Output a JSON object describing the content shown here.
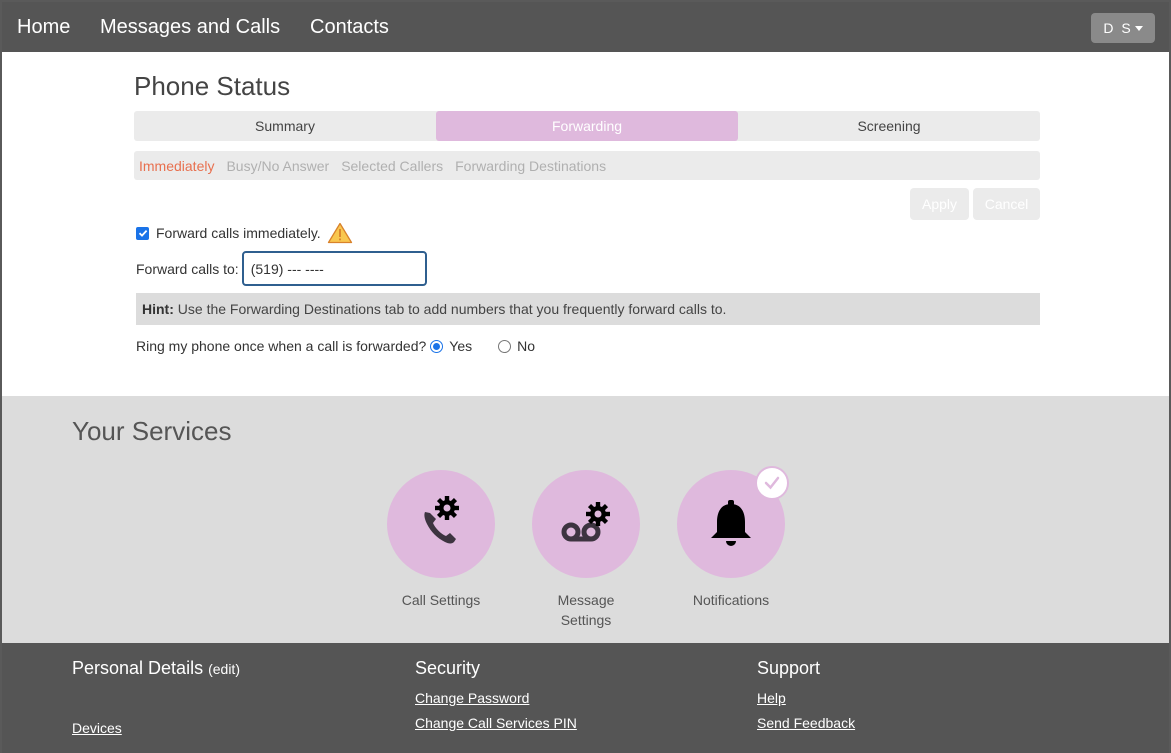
{
  "nav": {
    "items": [
      {
        "label": "Home"
      },
      {
        "label": "Messages and Calls"
      },
      {
        "label": "Contacts"
      }
    ],
    "user_initials": "D S"
  },
  "phone_status": {
    "title": "Phone Status",
    "tabs": [
      {
        "label": "Summary",
        "active": false
      },
      {
        "label": "Forwarding",
        "active": true
      },
      {
        "label": "Screening",
        "active": false
      }
    ],
    "subtabs": [
      {
        "label": "Immediately",
        "active": true
      },
      {
        "label": "Busy/No Answer",
        "active": false
      },
      {
        "label": "Selected Callers",
        "active": false
      },
      {
        "label": "Forwarding Destinations",
        "active": false
      }
    ],
    "apply_label": "Apply",
    "cancel_label": "Cancel",
    "forward_immediately_label": "Forward calls immediately.",
    "forward_immediately_checked": true,
    "forward_to_label": "Forward calls to:",
    "forward_to_value": "(519) --- ----",
    "hint_bold": "Hint:",
    "hint_text": " Use the Forwarding Destinations tab to add numbers that you frequently forward calls to.",
    "ring_question": "Ring my phone once when a call is forwarded?",
    "ring_options": [
      {
        "label": "Yes",
        "selected": true
      },
      {
        "label": "No",
        "selected": false
      }
    ]
  },
  "services": {
    "title": "Your Services",
    "items": [
      {
        "label": "Call Settings",
        "icon": "phone-gear-icon"
      },
      {
        "label": "Message Settings",
        "icon": "voicemail-gear-icon"
      },
      {
        "label": "Notifications",
        "icon": "bell-icon",
        "enabled_check": true
      }
    ]
  },
  "footer": {
    "personal_details": {
      "title": "Personal Details",
      "edit_label": "edit",
      "links": [
        "Devices"
      ]
    },
    "security": {
      "title": "Security",
      "links": [
        "Change Password",
        "Change Call Services PIN"
      ]
    },
    "support": {
      "title": "Support",
      "links": [
        "Help",
        "Send Feedback"
      ]
    }
  },
  "colors": {
    "accent": "#dfb9dd",
    "active_subtab": "#e8704f",
    "nav_bg": "#555555",
    "services_bg": "#dcdcdc"
  }
}
